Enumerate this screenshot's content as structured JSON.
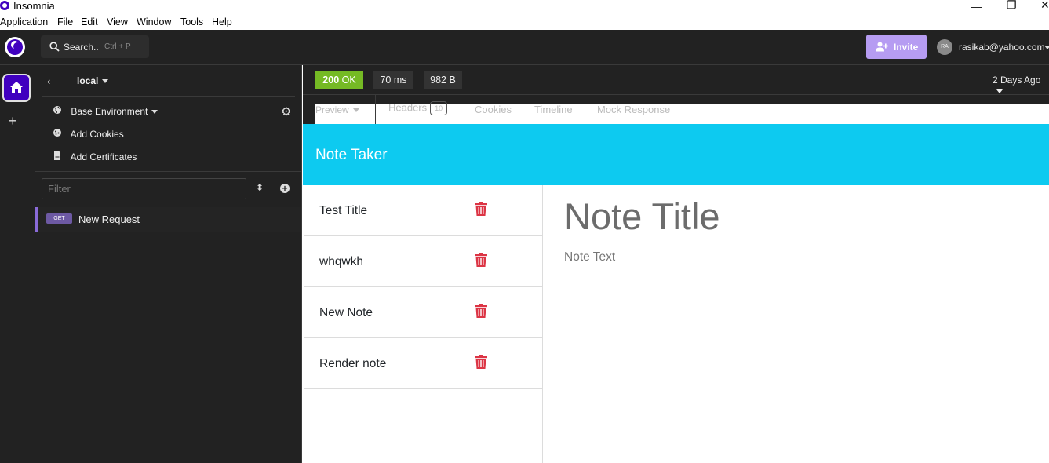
{
  "window": {
    "title": "Insomnia",
    "controls": {
      "minimize": "—",
      "restore": "❐",
      "close": "✕"
    }
  },
  "menu": [
    {
      "label": "Application"
    },
    {
      "label": "File"
    },
    {
      "label": "Edit"
    },
    {
      "label": "View"
    },
    {
      "label": "Window"
    },
    {
      "label": "Tools"
    },
    {
      "label": "Help"
    }
  ],
  "header": {
    "search_label": "Search..",
    "search_shortcut": "Ctrl + P",
    "invite_label": "Invite",
    "avatar_initials": "RA",
    "user_email": "rasikab@yahoo.com"
  },
  "sidebar": {
    "workspace": "local",
    "environment": "Base Environment",
    "add_cookies": "Add Cookies",
    "add_certificates": "Add Certificates",
    "filter_placeholder": "Filter",
    "requests": [
      {
        "method": "GET",
        "name": "New Request"
      }
    ]
  },
  "response": {
    "status_code": "200",
    "status_text": "OK",
    "time": "70 ms",
    "size": "982 B",
    "age": "2 Days Ago",
    "tabs": {
      "preview": "Preview",
      "headers": "Headers",
      "headers_count": "10",
      "cookies": "Cookies",
      "timeline": "Timeline",
      "mock": "Mock Response"
    }
  },
  "preview_app": {
    "brand": "Note Taker",
    "notes": [
      "Test Title",
      "whqwkh",
      "New Note",
      "Render note"
    ],
    "note_title_placeholder": "Note Title",
    "note_text_placeholder": "Note Text"
  },
  "colors": {
    "brand": "#4000bf",
    "invite": "#b69cf2",
    "status_ok": "#75ba24",
    "note_bar": "#0dcaf0",
    "delete": "#dc3545"
  }
}
